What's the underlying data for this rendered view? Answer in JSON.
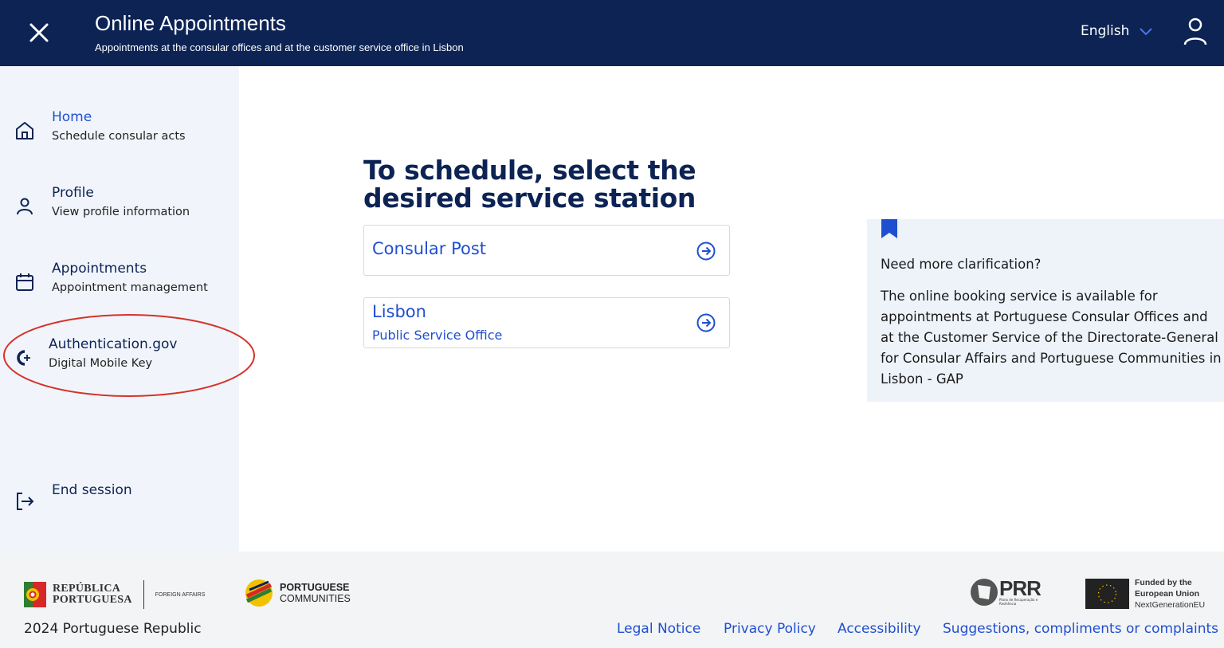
{
  "header": {
    "title": "Online Appointments",
    "subtitle": "Appointments at the consular offices and at the customer service office in Lisbon",
    "language": "English"
  },
  "sidebar": {
    "items": [
      {
        "title": "Home",
        "subtitle": "Schedule consular acts",
        "icon": "home-icon",
        "active": true
      },
      {
        "title": "Profile",
        "subtitle": "View profile information",
        "icon": "user-icon"
      },
      {
        "title": "Appointments",
        "subtitle": "Appointment management",
        "icon": "calendar-icon"
      },
      {
        "title": "Authentication.gov",
        "subtitle": "Digital Mobile Key",
        "icon": "authentication-gov-icon",
        "highlighted": true
      },
      {
        "title": "End session",
        "icon": "logout-icon"
      }
    ],
    "highlight_color": "#d6322a"
  },
  "main": {
    "title": "To schedule, select the desired service station",
    "options": [
      {
        "title": "Consular Post",
        "icon": "arrow-circle-right-icon"
      },
      {
        "title": "Lisbon",
        "subtitle": "Public Service Office",
        "icon": "arrow-circle-right-icon"
      }
    ]
  },
  "info": {
    "icon": "bookmark-icon",
    "title": "Need more clarification?",
    "text": "The online booking service is available for appointments at Portuguese Consular Offices and at the Customer Service of the Directorate-General for Consular Affairs and Portuguese Communities in Lisbon - GAP"
  },
  "footer": {
    "logo_republic_line1": "REPÚBLICA",
    "logo_republic_line2": "PORTUGUESA",
    "logo_republic_dept": "FOREIGN AFFAIRS",
    "logo_communities_line1": "PORTUGUESE",
    "logo_communities_line2": "COMMUNITIES",
    "logo_prr": "PRR",
    "logo_prr_small": "Plano de Recuperação e Resiliência",
    "logo_eu_line1": "Funded by the",
    "logo_eu_line2": "European Union",
    "logo_eu_line3": "NextGenerationEU",
    "copyright": "2024 Portuguese Republic",
    "links": [
      "Legal Notice",
      "Privacy Policy",
      "Accessibility",
      "Suggestions, compliments or complaints"
    ]
  },
  "colors": {
    "header_bg": "#0c2354",
    "sidebar_bg": "#f1f5fb",
    "accent": "#1f4fd1",
    "info_bg": "#eef3fa",
    "footer_bg": "#f3f4f6"
  }
}
